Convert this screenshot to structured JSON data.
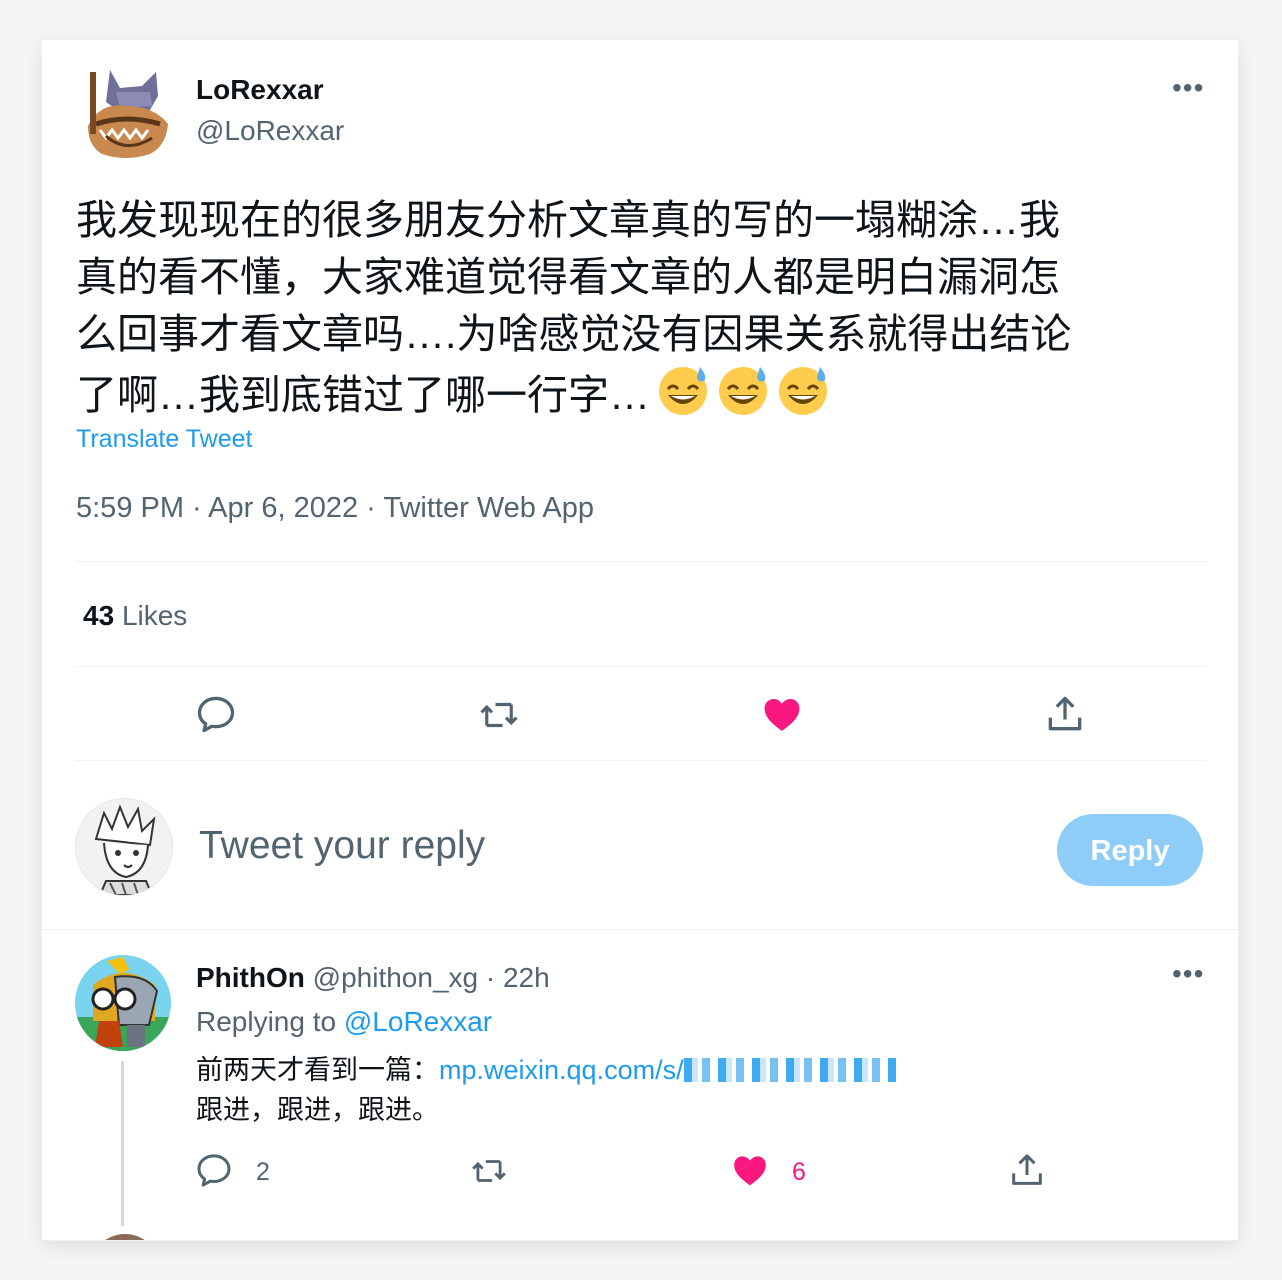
{
  "tweet": {
    "display_name": "LoRexxar",
    "handle": "@LoRexxar",
    "text_lines": [
      "我发现现在的很多朋友分析文章真的写的一塌糊涂…我",
      "真的看不懂，大家难道觉得看文章的人都是明白漏洞怎",
      "么回事才看文章吗….为啥感觉没有因果关系就得出结论",
      "了啊…我到底错过了哪一行字…"
    ],
    "emoji": [
      "😅",
      "😅",
      "😅"
    ],
    "translate_label": "Translate Tweet",
    "meta": "5:59 PM · Apr 6, 2022 · Twitter Web App",
    "likes_count": "43",
    "likes_label": "Likes",
    "more_icon": "more-horizontal-icon",
    "liked": true,
    "like_color": "#f91880"
  },
  "composer": {
    "placeholder": "Tweet your reply",
    "reply_label": "Reply",
    "reply_color": "#8ecdf7"
  },
  "reply": {
    "display_name": "PhithOn",
    "handle": "@phithon_xg",
    "time": "· 22h",
    "replying_prefix": "Replying to",
    "replying_handle": "@LoRexxar",
    "text_prefix": "前两天才看到一篇：",
    "link_text": "mp.weixin.qq.com/s/",
    "text_line2": "跟进，跟进，跟进。",
    "reply_count": "2",
    "like_count": "6"
  }
}
